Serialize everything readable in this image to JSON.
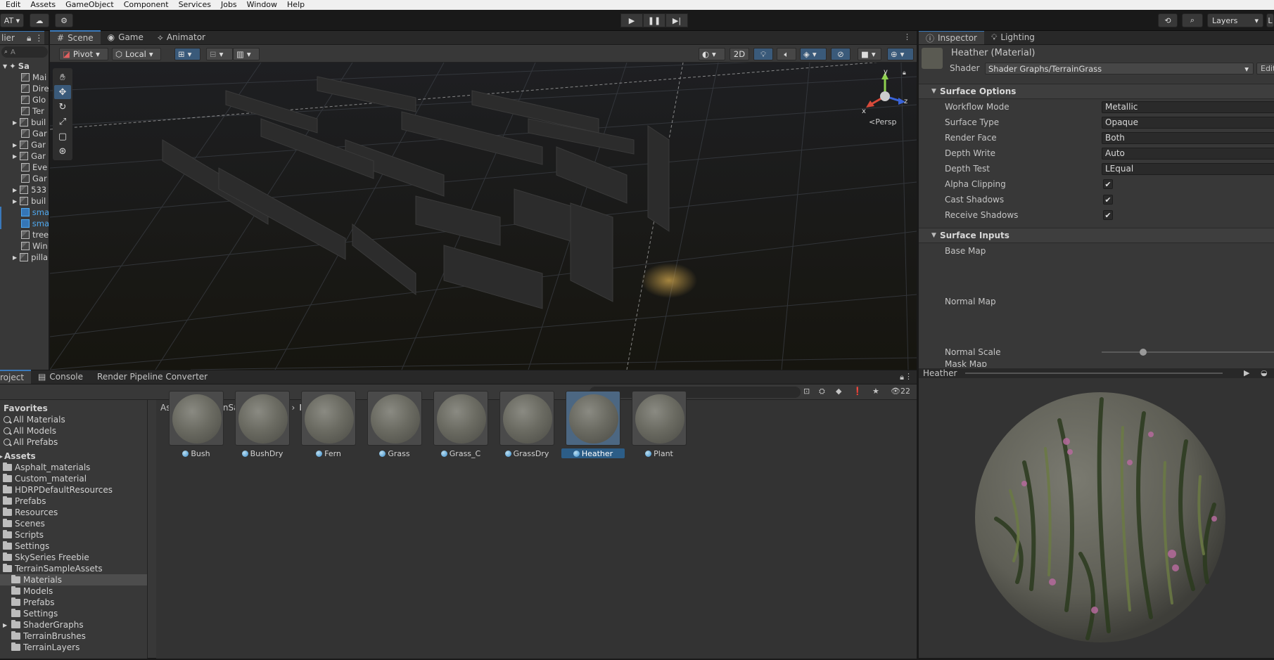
{
  "menubar": {
    "items": [
      "Edit",
      "Assets",
      "GameObject",
      "Component",
      "Services",
      "Jobs",
      "Window",
      "Help"
    ]
  },
  "toolbar": {
    "account": "AT",
    "layers_label": "Layers",
    "layout_label": "L"
  },
  "hierarchy": {
    "header": "lier",
    "search_placeholder": "A",
    "scene_label": "Sa",
    "items": [
      {
        "label": "Mai",
        "expandable": false,
        "selected": false
      },
      {
        "label": "Dire",
        "expandable": false,
        "selected": false
      },
      {
        "label": "Glo",
        "expandable": false,
        "selected": false
      },
      {
        "label": "Ter",
        "expandable": false,
        "selected": false
      },
      {
        "label": "buil",
        "expandable": true,
        "selected": false
      },
      {
        "label": "Gar",
        "expandable": false,
        "selected": false
      },
      {
        "label": "Gar",
        "expandable": true,
        "selected": false
      },
      {
        "label": "Gar",
        "expandable": true,
        "selected": false
      },
      {
        "label": "Eve",
        "expandable": false,
        "selected": false
      },
      {
        "label": "Gar",
        "expandable": false,
        "selected": false
      },
      {
        "label": "533",
        "expandable": true,
        "selected": false
      },
      {
        "label": "buil",
        "expandable": true,
        "selected": false
      },
      {
        "label": "sma",
        "expandable": false,
        "selected": true
      },
      {
        "label": "sma",
        "expandable": false,
        "selected": true
      },
      {
        "label": "tree",
        "expandable": false,
        "selected": false
      },
      {
        "label": "Win",
        "expandable": false,
        "selected": false
      },
      {
        "label": "pilla",
        "expandable": true,
        "selected": false
      }
    ]
  },
  "scene": {
    "tabs": [
      "Scene",
      "Game",
      "Animator"
    ],
    "pivot_label": "Pivot",
    "local_label": "Local",
    "two_d_label": "2D",
    "gizmo": {
      "x": "x",
      "y": "y",
      "z": "z",
      "persp": "Persp"
    }
  },
  "inspector": {
    "tabs": [
      "Inspector",
      "Lighting"
    ],
    "title": "Heather (Material)",
    "shader_label": "Shader",
    "shader_value": "Shader Graphs/TerrainGrass",
    "edit_label": "Edit",
    "surface_options": {
      "header": "Surface Options",
      "rows": [
        {
          "label": "Workflow Mode",
          "value": "Metallic"
        },
        {
          "label": "Surface Type",
          "value": "Opaque"
        },
        {
          "label": "Render Face",
          "value": "Both"
        },
        {
          "label": "Depth Write",
          "value": "Auto"
        },
        {
          "label": "Depth Test",
          "value": "LEqual"
        }
      ],
      "checks": [
        {
          "label": "Alpha Clipping",
          "checked": true
        },
        {
          "label": "Cast Shadows",
          "checked": true
        },
        {
          "label": "Receive Shadows",
          "checked": true
        }
      ]
    },
    "surface_inputs": {
      "header": "Surface Inputs",
      "base_map": "Base Map",
      "normal_map": "Normal Map",
      "normal_scale": "Normal Scale",
      "normal_scale_value": 0.24,
      "mask_map": "Mask Map"
    }
  },
  "preview": {
    "title": "Heather"
  },
  "project": {
    "tabs": [
      "roject",
      "Console",
      "Render Pipeline Converter"
    ],
    "count": "22",
    "favorites": {
      "header": "Favorites",
      "items": [
        "All Materials",
        "All Models",
        "All Prefabs"
      ]
    },
    "assets_header": "Assets",
    "folders": [
      {
        "label": "Asphalt_materials",
        "level": 0,
        "selected": false,
        "expandable": false
      },
      {
        "label": "Custom_material",
        "level": 0,
        "selected": false,
        "expandable": false
      },
      {
        "label": "HDRPDefaultResources",
        "level": 0,
        "selected": false,
        "expandable": false
      },
      {
        "label": "Prefabs",
        "level": 0,
        "selected": false,
        "expandable": false
      },
      {
        "label": "Resources",
        "level": 0,
        "selected": false,
        "expandable": false
      },
      {
        "label": "Scenes",
        "level": 0,
        "selected": false,
        "expandable": false
      },
      {
        "label": "Scripts",
        "level": 0,
        "selected": false,
        "expandable": false
      },
      {
        "label": "Settings",
        "level": 0,
        "selected": false,
        "expandable": false
      },
      {
        "label": "SkySeries Freebie",
        "level": 0,
        "selected": false,
        "expandable": false
      },
      {
        "label": "TerrainSampleAssets",
        "level": 0,
        "selected": false,
        "expandable": false
      },
      {
        "label": "Materials",
        "level": 1,
        "selected": true,
        "expandable": false
      },
      {
        "label": "Models",
        "level": 1,
        "selected": false,
        "expandable": false
      },
      {
        "label": "Prefabs",
        "level": 1,
        "selected": false,
        "expandable": false
      },
      {
        "label": "Settings",
        "level": 1,
        "selected": false,
        "expandable": false
      },
      {
        "label": "ShaderGraphs",
        "level": 1,
        "selected": false,
        "expandable": true
      },
      {
        "label": "TerrainBrushes",
        "level": 1,
        "selected": false,
        "expandable": false
      },
      {
        "label": "TerrainLayers",
        "level": 1,
        "selected": false,
        "expandable": false
      }
    ],
    "breadcrumb": [
      "Assets",
      "TerrainSampleAssets",
      "Materials"
    ],
    "assets": [
      {
        "label": "Bush",
        "selected": false
      },
      {
        "label": "BushDry",
        "selected": false
      },
      {
        "label": "Fern",
        "selected": false
      },
      {
        "label": "Grass",
        "selected": false
      },
      {
        "label": "Grass_C",
        "selected": false
      },
      {
        "label": "GrassDry",
        "selected": false
      },
      {
        "label": "Heather",
        "selected": true
      },
      {
        "label": "Plant",
        "selected": false
      }
    ]
  }
}
